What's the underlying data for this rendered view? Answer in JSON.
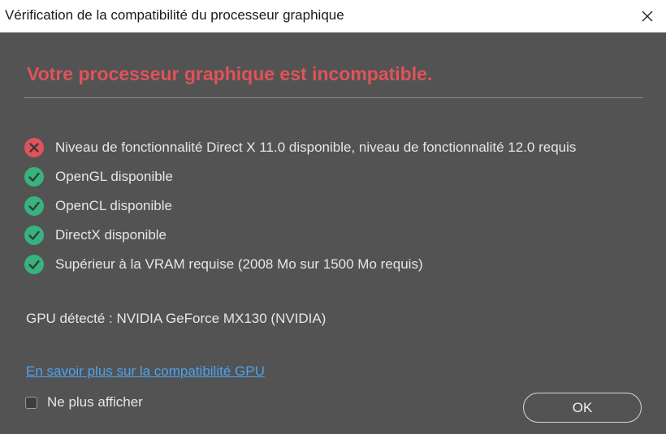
{
  "window": {
    "title": "Vérification de la compatibilité du processeur graphique",
    "close_icon": "close-icon"
  },
  "heading": "Votre processeur graphique est incompatible.",
  "colors": {
    "error": "#e0535a",
    "success": "#36b37e",
    "link": "#4ca3f0",
    "background": "#535353"
  },
  "checks": [
    {
      "status": "error",
      "icon": "error-x-icon",
      "label": "Niveau de fonctionnalité Direct X 11.0 disponible, niveau de fonctionnalité 12.0 requis"
    },
    {
      "status": "ok",
      "icon": "check-circle-icon",
      "label": "OpenGL disponible"
    },
    {
      "status": "ok",
      "icon": "check-circle-icon",
      "label": "OpenCL disponible"
    },
    {
      "status": "ok",
      "icon": "check-circle-icon",
      "label": "DirectX disponible"
    },
    {
      "status": "ok",
      "icon": "check-circle-icon",
      "label": "Supérieur à la VRAM requise (2008 Mo sur 1500 Mo requis)"
    }
  ],
  "gpu_detected": "GPU détecté : NVIDIA GeForce MX130 (NVIDIA)",
  "learn_more_link": "En savoir plus sur la compatibilité GPU",
  "dont_show_again": {
    "label": "Ne plus afficher",
    "checked": false
  },
  "ok_button": "OK"
}
